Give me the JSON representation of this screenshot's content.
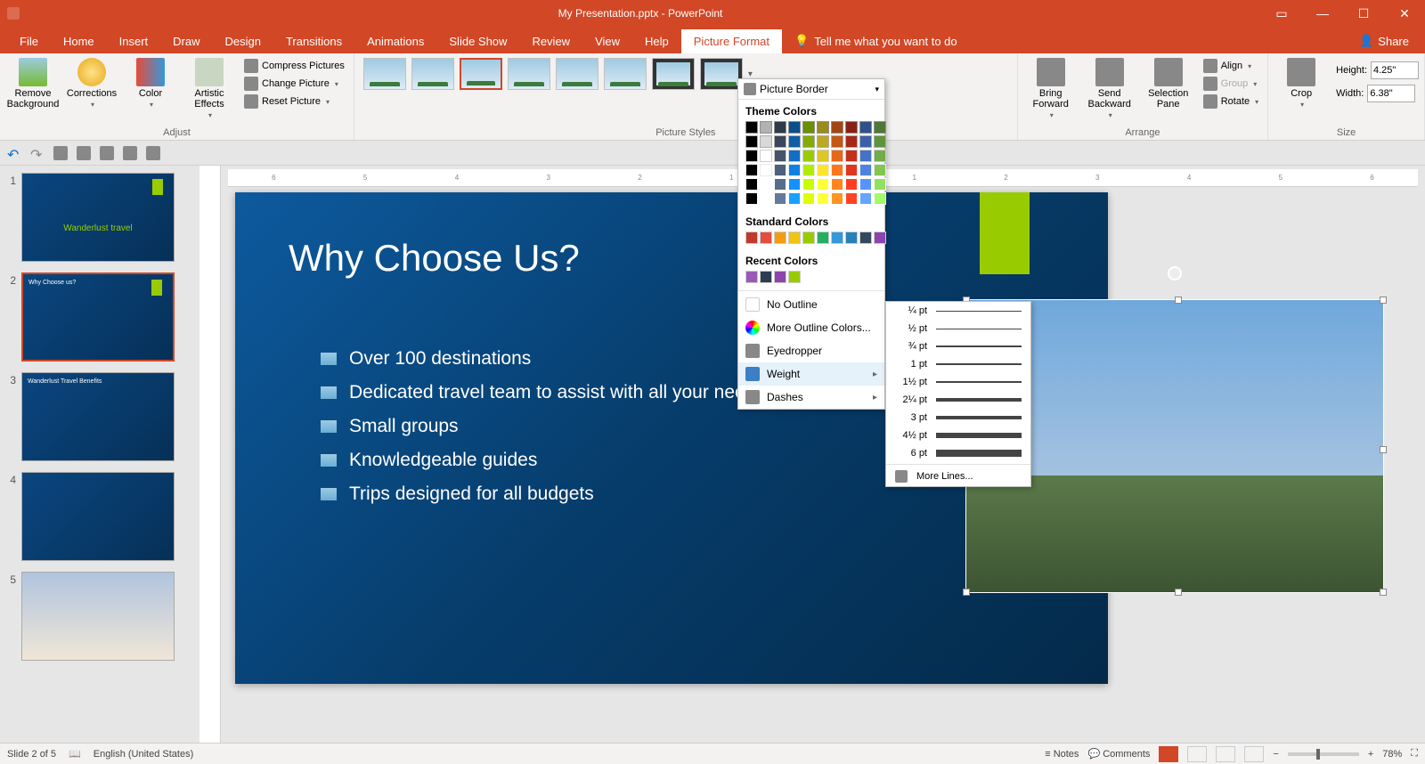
{
  "title": "My Presentation.pptx  -  PowerPoint",
  "tabs": [
    "File",
    "Home",
    "Insert",
    "Draw",
    "Design",
    "Transitions",
    "Animations",
    "Slide Show",
    "Review",
    "View",
    "Help",
    "Picture Format"
  ],
  "active_tab": "Picture Format",
  "tellme": "Tell me what you want to do",
  "share": "Share",
  "ribbon": {
    "adjust": {
      "label": "Adjust",
      "remove_bg": "Remove Background",
      "corrections": "Corrections",
      "color": "Color",
      "artistic": "Artistic Effects",
      "compress": "Compress Pictures",
      "change": "Change Picture",
      "reset": "Reset Picture"
    },
    "styles_label": "Picture Styles",
    "border_btn": "Picture Border",
    "arrange": {
      "label": "Arrange",
      "forward": "Bring Forward",
      "backward": "Send Backward",
      "selpane": "Selection Pane",
      "align": "Align",
      "group": "Group",
      "rotate": "Rotate"
    },
    "size": {
      "label": "Size",
      "crop": "Crop",
      "height_lbl": "Height:",
      "width_lbl": "Width:",
      "height": "4.25\"",
      "width": "6.38\""
    }
  },
  "popup": {
    "theme_hdr": "Theme Colors",
    "standard_hdr": "Standard Colors",
    "recent_hdr": "Recent Colors",
    "no_outline": "No Outline",
    "more_colors": "More Outline Colors...",
    "eyedropper": "Eyedropper",
    "weight": "Weight",
    "dashes": "Dashes",
    "theme_row1": [
      "#000000",
      "#ffffff",
      "#44546a",
      "#0f6fc6",
      "#99cc00",
      "#dec627",
      "#e76618",
      "#c42f1a",
      "#4472c4",
      "#70ad47"
    ],
    "standard": [
      "#c0392b",
      "#e74c3c",
      "#f39c12",
      "#f1c40f",
      "#99cc00",
      "#27ae60",
      "#3498db",
      "#2980b9",
      "#34495e",
      "#8e44ad"
    ],
    "recent": [
      "#9b59b6",
      "#2c3e50",
      "#8e44ad",
      "#99cc00"
    ]
  },
  "flyout": {
    "weights": [
      {
        "label": "¼ pt",
        "h": 0.5
      },
      {
        "label": "½ pt",
        "h": 1
      },
      {
        "label": "¾ pt",
        "h": 1.5
      },
      {
        "label": "1 pt",
        "h": 2
      },
      {
        "label": "1½ pt",
        "h": 2.5
      },
      {
        "label": "2¼ pt",
        "h": 3.5
      },
      {
        "label": "3 pt",
        "h": 4.5
      },
      {
        "label": "4½ pt",
        "h": 6
      },
      {
        "label": "6 pt",
        "h": 8
      }
    ],
    "more": "More Lines..."
  },
  "slide": {
    "title": "Why Choose Us?",
    "bullets": [
      "Over 100 destinations",
      "Dedicated travel team to assist with all your needs",
      "Small groups",
      "Knowledgeable guides",
      "Trips designed for all budgets"
    ]
  },
  "thumbs": [
    {
      "n": "1",
      "title": "Wanderlust travel"
    },
    {
      "n": "2",
      "title": "Why Choose us?"
    },
    {
      "n": "3",
      "title": "Wanderlust Travel Benefits"
    },
    {
      "n": "4",
      "title": ""
    },
    {
      "n": "5",
      "title": ""
    }
  ],
  "status": {
    "slide": "Slide 2 of 5",
    "lang": "English (United States)",
    "notes": "Notes",
    "comments": "Comments",
    "zoom": "78%"
  }
}
